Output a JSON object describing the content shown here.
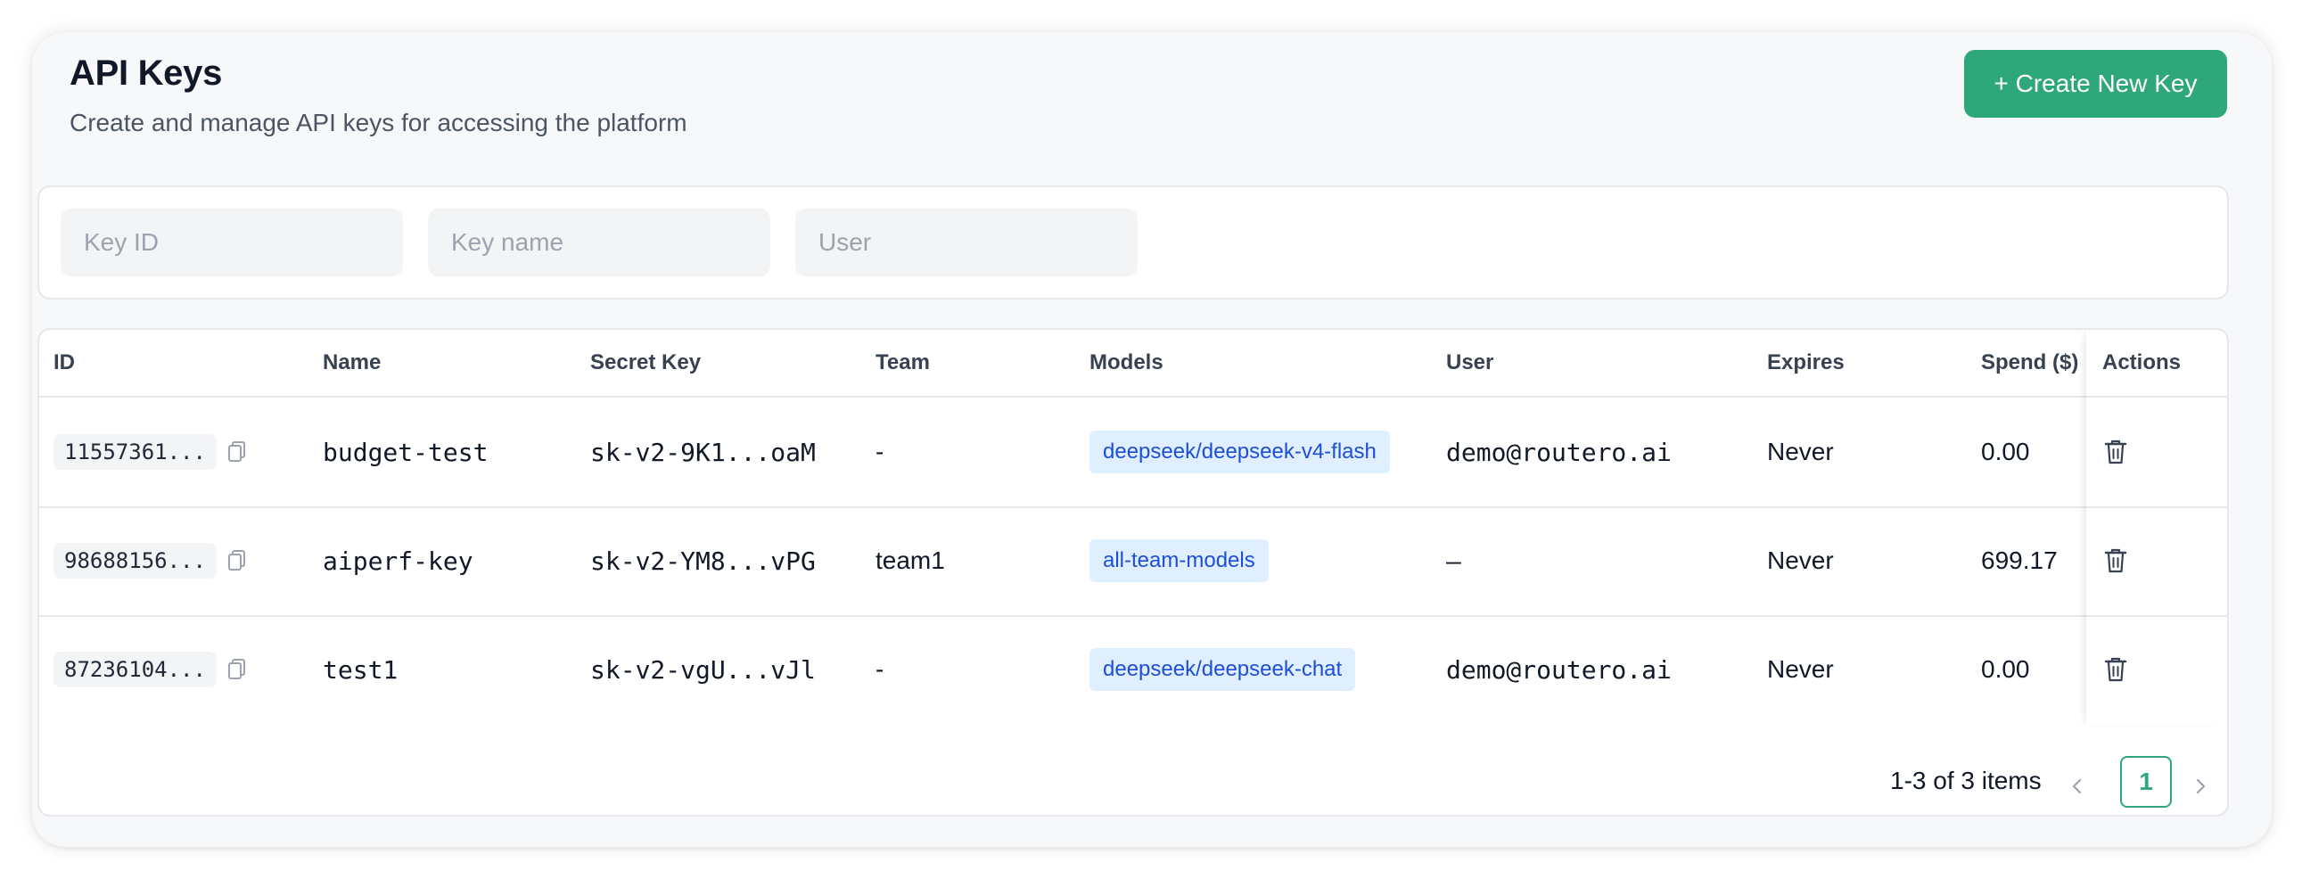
{
  "header": {
    "title": "API Keys",
    "subtitle": "Create and manage API keys for accessing the platform",
    "create_button_label": "+ Create New Key"
  },
  "filters": {
    "key_id_placeholder": "Key ID",
    "key_name_placeholder": "Key name",
    "user_placeholder": "User"
  },
  "table": {
    "columns": [
      "ID",
      "Name",
      "Secret Key",
      "Team",
      "Models",
      "User",
      "Expires",
      "Spend ($)",
      "Actions"
    ],
    "rows": [
      {
        "id": "11557361...",
        "name": "budget-test",
        "secret_key": "sk-v2-9K1...oaM",
        "team": "-",
        "model": "deepseek/deepseek-v4-flash",
        "user": "demo@routero.ai",
        "expires": "Never",
        "spend": "0.00"
      },
      {
        "id": "98688156...",
        "name": "aiperf-key",
        "secret_key": "sk-v2-YM8...vPG",
        "team": "team1",
        "model": "all-team-models",
        "user": "–",
        "expires": "Never",
        "spend": "699.17"
      },
      {
        "id": "87236104...",
        "name": "test1",
        "secret_key": "sk-v2-vgU...vJl",
        "team": "-",
        "model": "deepseek/deepseek-chat",
        "user": "demo@routero.ai",
        "expires": "Never",
        "spend": "0.00"
      }
    ]
  },
  "pagination": {
    "summary": "1-3 of 3 items",
    "current_page": "1"
  },
  "icons": {
    "copy": "copy-icon",
    "delete": "trash-icon",
    "prev": "chevron-left-icon",
    "next": "chevron-right-icon"
  },
  "colors": {
    "accent": "#2ea77a",
    "tag_bg": "#e0efff",
    "tag_text": "#1d4ed8"
  }
}
